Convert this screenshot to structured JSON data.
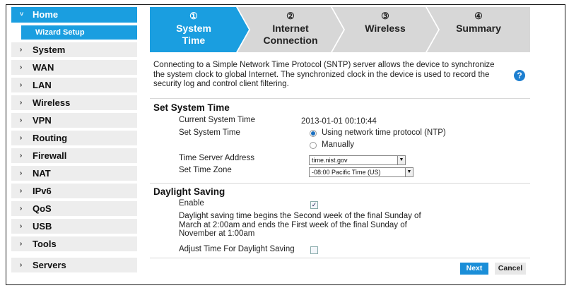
{
  "sidebar": {
    "items": [
      {
        "label": "Home",
        "arrow": "˅"
      },
      {
        "label": "System",
        "arrow": "›"
      },
      {
        "label": "WAN",
        "arrow": "›"
      },
      {
        "label": "LAN",
        "arrow": "›"
      },
      {
        "label": "Wireless",
        "arrow": "›"
      },
      {
        "label": "VPN",
        "arrow": "›"
      },
      {
        "label": "Routing",
        "arrow": "›"
      },
      {
        "label": "Firewall",
        "arrow": "›"
      },
      {
        "label": "NAT",
        "arrow": "›"
      },
      {
        "label": "IPv6",
        "arrow": "›"
      },
      {
        "label": "QoS",
        "arrow": "›"
      },
      {
        "label": "USB",
        "arrow": "›"
      },
      {
        "label": "Tools",
        "arrow": "›"
      },
      {
        "label": "Servers",
        "arrow": "›"
      }
    ],
    "sub_item": "Wizard Setup"
  },
  "steps": [
    {
      "num": "①",
      "line1": "System",
      "line2": "Time"
    },
    {
      "num": "②",
      "line1": "Internet",
      "line2": "Connection"
    },
    {
      "num": "③",
      "line1": "Wireless",
      "line2": ""
    },
    {
      "num": "④",
      "line1": "Summary",
      "line2": ""
    }
  ],
  "colors": {
    "accent": "#1a9ee0",
    "step_active": "#1a9ee0",
    "step_inactive": "#d7d7d7"
  },
  "intro": "Connecting to a Simple Network Time Protocol (SNTP) server allows the device to synchronize the system clock to global Internet. The synchronized clock in the device is used to record the security log and control client filtering.",
  "help_icon": "?",
  "system_time": {
    "title": "Set System Time",
    "current_label": "Current System Time",
    "current_value": "2013-01-01  00:10:44",
    "set_label": "Set System Time",
    "option_ntp": "Using network time protocol (NTP)",
    "option_manual": "Manually",
    "server_label": "Time Server Address",
    "server_value": "time.nist.gov",
    "zone_label": "Set Time Zone",
    "zone_value": "-08:00 Pacific Time (US)"
  },
  "dst": {
    "title": "Daylight Saving",
    "enable_label": "Enable",
    "description": "Daylight saving time begins the Second week of the final Sunday of March at 2:00am and ends the First week of the final Sunday of November at 1:00am",
    "adjust_label": "Adjust Time For Daylight Saving"
  },
  "buttons": {
    "next": "Next",
    "cancel": "Cancel"
  }
}
